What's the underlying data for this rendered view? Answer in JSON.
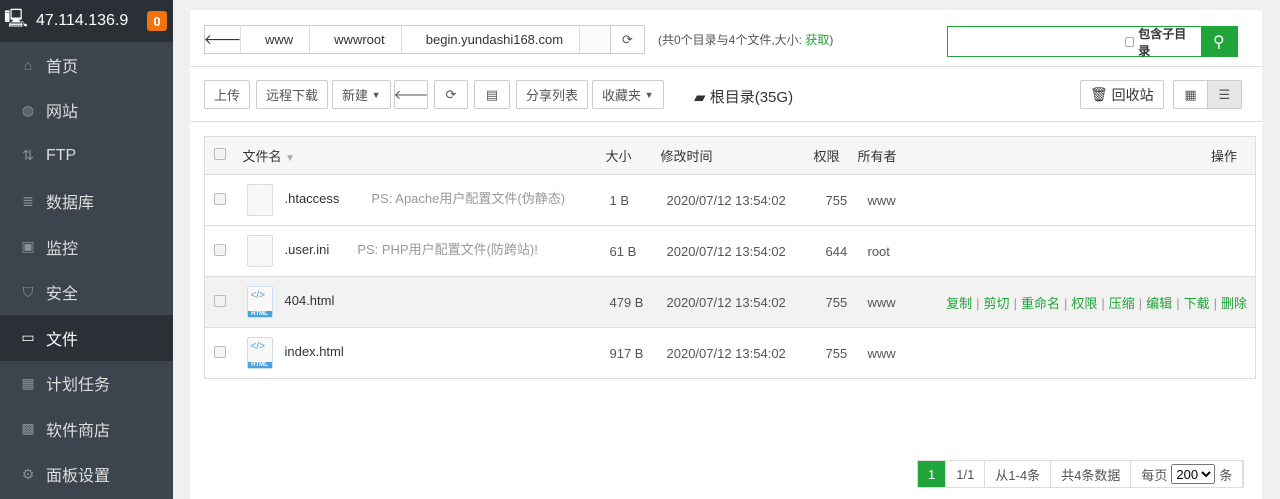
{
  "sidebar": {
    "server_ip": "47.114.136.9",
    "badge": "0",
    "items": [
      {
        "label": "首页",
        "icon": "⌂"
      },
      {
        "label": "网站",
        "icon": "◍"
      },
      {
        "label": "FTP",
        "icon": "⇅"
      },
      {
        "label": "数据库",
        "icon": "≣"
      },
      {
        "label": "监控",
        "icon": "▣"
      },
      {
        "label": "安全",
        "icon": "⛉"
      },
      {
        "label": "文件",
        "icon": "▭"
      },
      {
        "label": "计划任务",
        "icon": "▦"
      },
      {
        "label": "软件商店",
        "icon": "▩"
      },
      {
        "label": "面板设置",
        "icon": "⚙"
      }
    ],
    "active": "文件"
  },
  "path": {
    "segments": [
      "www",
      "wwwroot",
      "begin.yundashi168.com"
    ]
  },
  "info": {
    "text": "(共0个目录与4个文件,大小: ",
    "link": "获取",
    "close": ")"
  },
  "search": {
    "placeholder": "",
    "subdir_label": "包含子目录"
  },
  "toolbar": {
    "upload": "上传",
    "remote_download": "远程下载",
    "new": "新建",
    "share_list": "分享列表",
    "favorites": "收藏夹",
    "root_dir": "根目录(35G)",
    "recycle": "回收站"
  },
  "table": {
    "headers": {
      "name": "文件名",
      "size": "大小",
      "mtime": "修改时间",
      "perm": "权限",
      "owner": "所有者",
      "ops": "操作"
    },
    "rows": [
      {
        "name": ".htaccess",
        "ps": "PS: Apache用户配置文件(伪静态)",
        "size": "1 B",
        "mtime": "2020/07/12 13:54:02",
        "perm": "755",
        "owner": "www",
        "type": "file"
      },
      {
        "name": ".user.ini",
        "ps": "PS: PHP用户配置文件(防跨站)!",
        "size": "61 B",
        "mtime": "2020/07/12 13:54:02",
        "perm": "644",
        "owner": "root",
        "type": "file"
      },
      {
        "name": "404.html",
        "ps": "",
        "size": "479 B",
        "mtime": "2020/07/12 13:54:02",
        "perm": "755",
        "owner": "www",
        "type": "html"
      },
      {
        "name": "index.html",
        "ps": "",
        "size": "917 B",
        "mtime": "2020/07/12 13:54:02",
        "perm": "755",
        "owner": "www",
        "type": "html"
      }
    ],
    "ops": [
      "复制",
      "剪切",
      "重命名",
      "权限",
      "压缩",
      "编辑",
      "下载",
      "删除"
    ],
    "html_tag": "HTML"
  },
  "pager": {
    "current": "1",
    "pages": "1/1",
    "range": "从1-4条",
    "total": "共4条数据",
    "per_page_label": "每页",
    "per_page": "200",
    "unit": "条"
  }
}
